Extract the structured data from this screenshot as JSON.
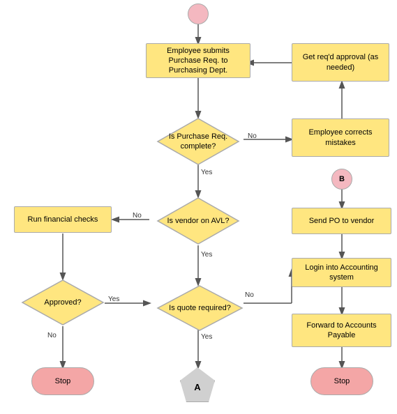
{
  "nodes": {
    "start": {
      "label": ""
    },
    "employee_submits": {
      "label": "Employee submits\nPurchase Req. to\nPurchasing Dept."
    },
    "get_approval": {
      "label": "Get req'd approval (as\nneeded)"
    },
    "is_complete": {
      "label": "Is Purchase Req.\ncomplete?"
    },
    "employee_corrects": {
      "label": "Employee corrects\nmistakes"
    },
    "circle_b": {
      "label": "B"
    },
    "is_vendor_avl": {
      "label": "Is vendor on AVL?"
    },
    "run_financial": {
      "label": "Run financial checks"
    },
    "send_po": {
      "label": "Send PO to vendor"
    },
    "approved": {
      "label": "Approved?"
    },
    "is_quote": {
      "label": "Is quote required?"
    },
    "login_accounting": {
      "label": "Login into Accounting\nsystem"
    },
    "forward_ap": {
      "label": "Forward to Accounts\nPayable"
    },
    "stop_left": {
      "label": "Stop"
    },
    "pentagon_a": {
      "label": "A"
    },
    "stop_right": {
      "label": "Stop"
    }
  },
  "labels": {
    "no1": "No",
    "yes1": "Yes",
    "no2": "No",
    "yes2": "Yes",
    "no3": "No",
    "yes3": "Yes",
    "no4": "No",
    "yes4": "Yes"
  }
}
